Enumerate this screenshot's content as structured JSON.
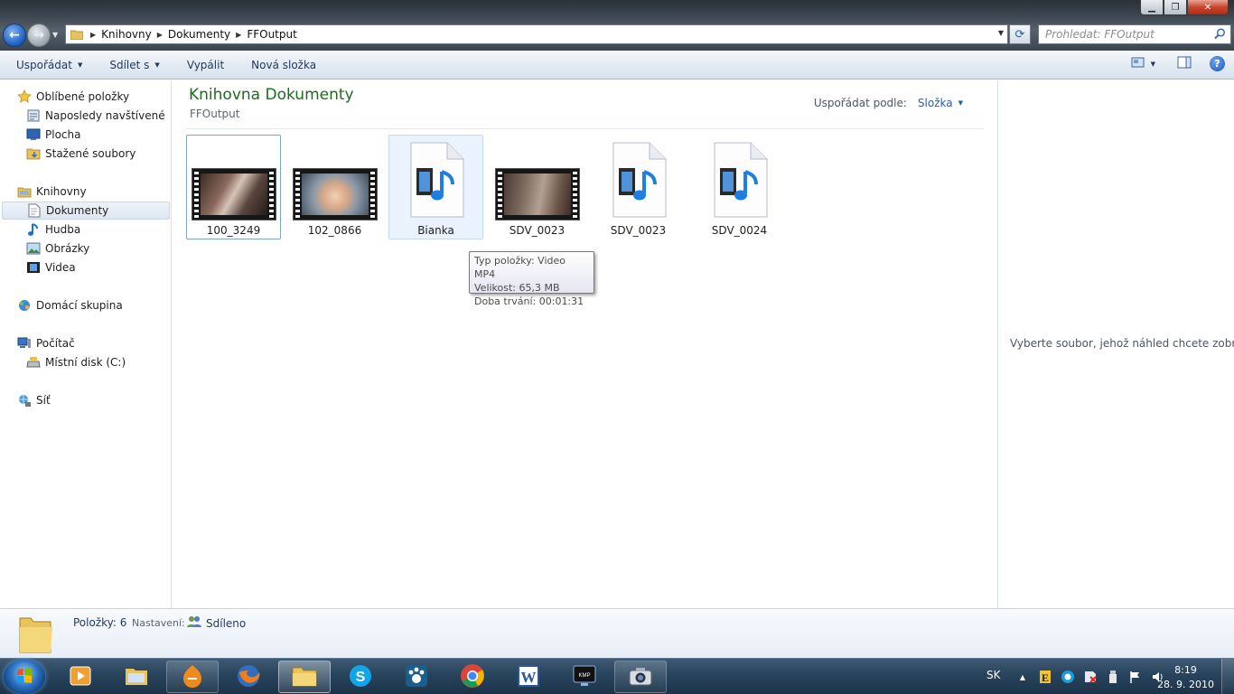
{
  "address": {
    "crumbs": [
      "Knihovny",
      "Dokumenty",
      "FFOutput"
    ],
    "search_placeholder": "Prohledat: FFOutput"
  },
  "toolbar": {
    "organize": "Uspořádat",
    "share": "Sdílet s",
    "burn": "Vypálit",
    "new_folder": "Nová složka"
  },
  "nav": {
    "favorites": "Oblíbené položky",
    "recent": "Naposledy navštívené",
    "desktop": "Plocha",
    "downloads": "Stažené soubory",
    "libraries": "Knihovny",
    "documents": "Dokumenty",
    "music": "Hudba",
    "pictures": "Obrázky",
    "videos": "Videa",
    "homegroup": "Domácí skupina",
    "computer": "Počítač",
    "local_disk": "Místní disk (C:)",
    "network": "Síť"
  },
  "content": {
    "title": "Knihovna Dokumenty",
    "subtitle": "FFOutput",
    "arrange_label": "Uspořádat podle:",
    "arrange_value": "Složka",
    "files": [
      {
        "name": "100_3249",
        "kind": "video-thumbnail"
      },
      {
        "name": "102_0866",
        "kind": "video-thumbnail"
      },
      {
        "name": "Bianka",
        "kind": "media-file-icon"
      },
      {
        "name": "SDV_0023",
        "kind": "video-thumbnail"
      },
      {
        "name": "SDV_0023",
        "kind": "media-file-icon"
      },
      {
        "name": "SDV_0024",
        "kind": "media-file-icon"
      }
    ]
  },
  "tooltip": {
    "type": "Typ položky: Video MP4",
    "size": "Velikost: 65,3 MB",
    "duration": "Doba trvání: 00:01:31"
  },
  "preview": {
    "message": "Vyberte soubor, jehož náhled chcete zobrazit."
  },
  "details": {
    "count": "Položky: 6",
    "settings_label": "Nastavení:",
    "shared": "Sdíleno"
  },
  "taskbar": {
    "language": "SK",
    "time": "8:19",
    "date": "28. 9. 2010",
    "apps": [
      "media-player-icon",
      "explorer-icon",
      "winamp-icon",
      "firefox-icon",
      "folder-icon",
      "skype-icon",
      "app-paw-icon",
      "chrome-icon",
      "word-icon",
      "kmplayer-icon",
      "camera-icon"
    ]
  },
  "colors": {
    "title_green": "#1e6b1e",
    "link_blue": "#1f5fb3",
    "taskbar": "#28445d"
  }
}
